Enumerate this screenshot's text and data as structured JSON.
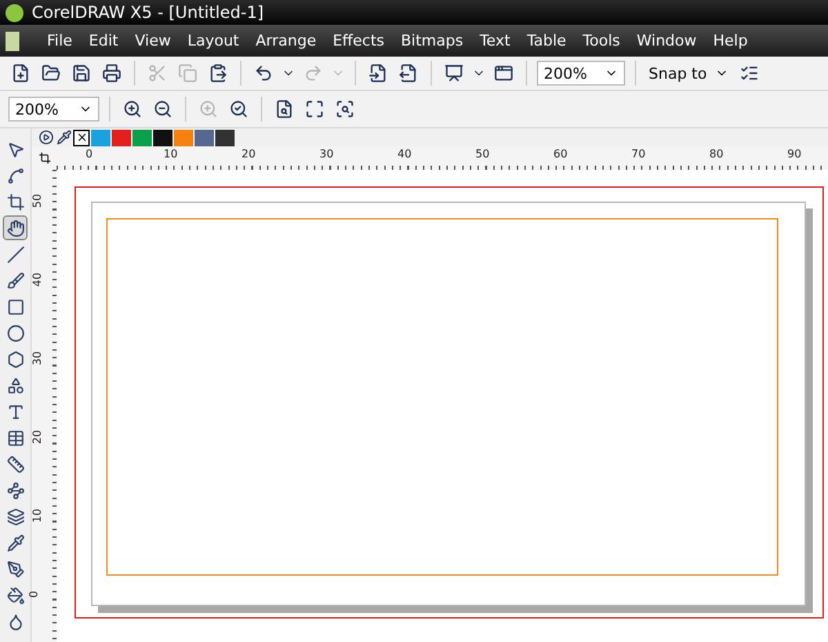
{
  "window": {
    "title": "CorelDRAW X5 - [Untitled-1]"
  },
  "menu": [
    "File",
    "Edit",
    "View",
    "Layout",
    "Arrange",
    "Effects",
    "Bitmaps",
    "Text",
    "Table",
    "Tools",
    "Window",
    "Help"
  ],
  "standard_toolbar": {
    "buttons": [
      {
        "disabled": false
      },
      {
        "disabled": false
      },
      {
        "disabled": false
      },
      {
        "disabled": false
      },
      {
        "disabled": true
      },
      {
        "disabled": true
      },
      {
        "disabled": false
      },
      {
        "disabled": false
      },
      {
        "disabled": true
      },
      {
        "disabled": false
      },
      {
        "disabled": false
      },
      {
        "disabled": false
      },
      {
        "disabled": false
      }
    ],
    "zoom": "200%",
    "snap": "Snap to"
  },
  "zoom_toolbar": {
    "zoom": "200%",
    "buttons": [
      {
        "disabled": false
      },
      {
        "disabled": false
      },
      {
        "disabled": true
      },
      {
        "disabled": false
      },
      {
        "disabled": false
      },
      {
        "disabled": false
      },
      {
        "disabled": false
      }
    ]
  },
  "palette": [
    {
      "color": "#1ba1dc"
    },
    {
      "color": "#e3201b"
    },
    {
      "color": "#0da04c"
    },
    {
      "color": "#111111"
    },
    {
      "color": "#f5820f"
    },
    {
      "color": "#566890"
    },
    {
      "color": "#323232"
    }
  ],
  "toolbox": [
    {
      "selected": false
    },
    {
      "selected": false
    },
    {
      "selected": false
    },
    {
      "selected": true
    },
    {
      "selected": false
    },
    {
      "selected": false
    },
    {
      "selected": false
    },
    {
      "selected": false
    },
    {
      "selected": false
    },
    {
      "selected": false
    },
    {
      "selected": false
    },
    {
      "selected": false
    },
    {
      "selected": false
    },
    {
      "selected": false
    },
    {
      "selected": false
    },
    {
      "selected": false
    },
    {
      "selected": false
    },
    {
      "selected": false
    },
    {
      "selected": false
    }
  ],
  "horizontal_ruler": [
    "0",
    "10",
    "20",
    "30",
    "40",
    "50",
    "60",
    "70",
    "80",
    "90"
  ],
  "vertical_ruler": [
    "50",
    "40",
    "30",
    "20",
    "10",
    "0"
  ]
}
